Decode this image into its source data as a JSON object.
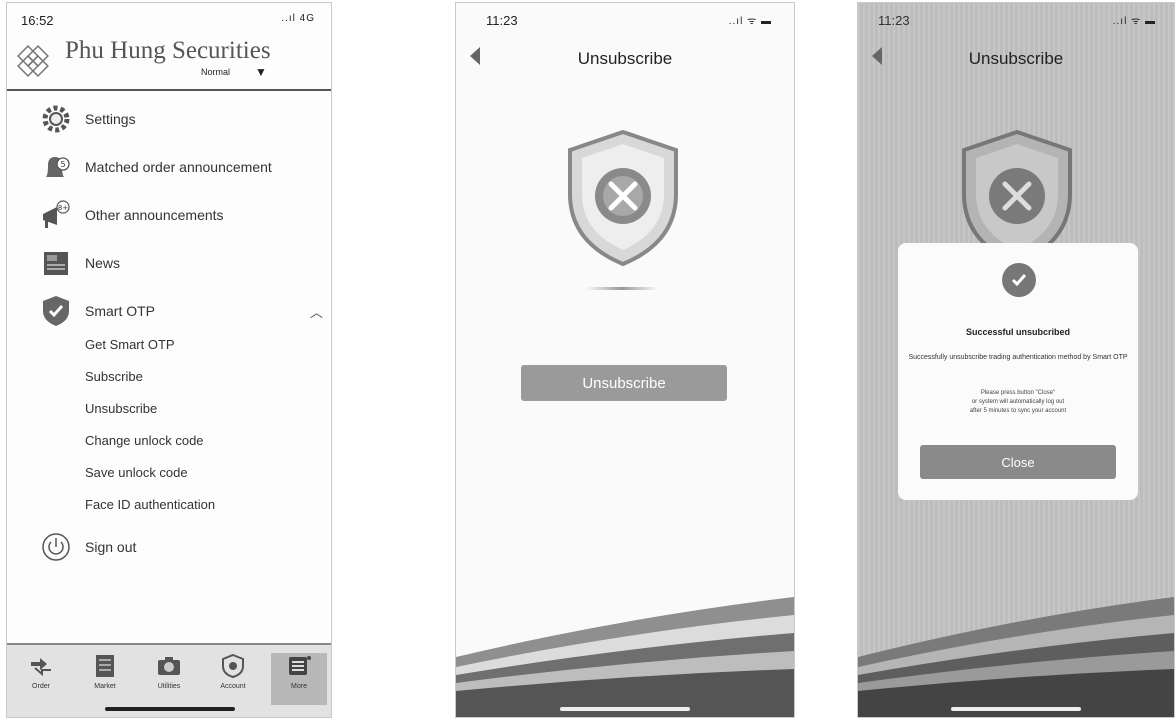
{
  "screen1": {
    "status_time": "16:52",
    "status_signal": "..ıl 4G",
    "brand": "Phu Hung Securities",
    "mode": "Normal",
    "menu": [
      {
        "label": "Settings",
        "icon": "gear-icon"
      },
      {
        "label": "Matched order announcement",
        "icon": "bell-icon"
      },
      {
        "label": "Other announcements",
        "icon": "megaphone-icon"
      },
      {
        "label": "News",
        "icon": "newspaper-icon"
      },
      {
        "label": "Smart OTP",
        "icon": "shield-check-icon"
      }
    ],
    "otp_submenu": [
      "Get Smart OTP",
      "Subscribe",
      "Unsubscribe",
      "Change unlock code",
      "Save unlock code",
      "Face ID authentication"
    ],
    "sign_out": "Sign out",
    "tabs": [
      "Order",
      "Market",
      "Utilities",
      "Account",
      "More"
    ]
  },
  "screen2": {
    "status_time": "11:23",
    "title": "Unsubscribe",
    "button": "Unsubscribe"
  },
  "screen3": {
    "status_time": "11:23",
    "title": "Unsubscribe",
    "dialog_title": "Successful unsubcribed",
    "dialog_message": "Successfully unsubscribe trading authentication method by Smart OTP",
    "dialog_note_1": "Please press button \"Close\"",
    "dialog_note_2": "or system will automatically log out",
    "dialog_note_3": "after 5 minutes to sync your account",
    "close_button": "Close"
  }
}
